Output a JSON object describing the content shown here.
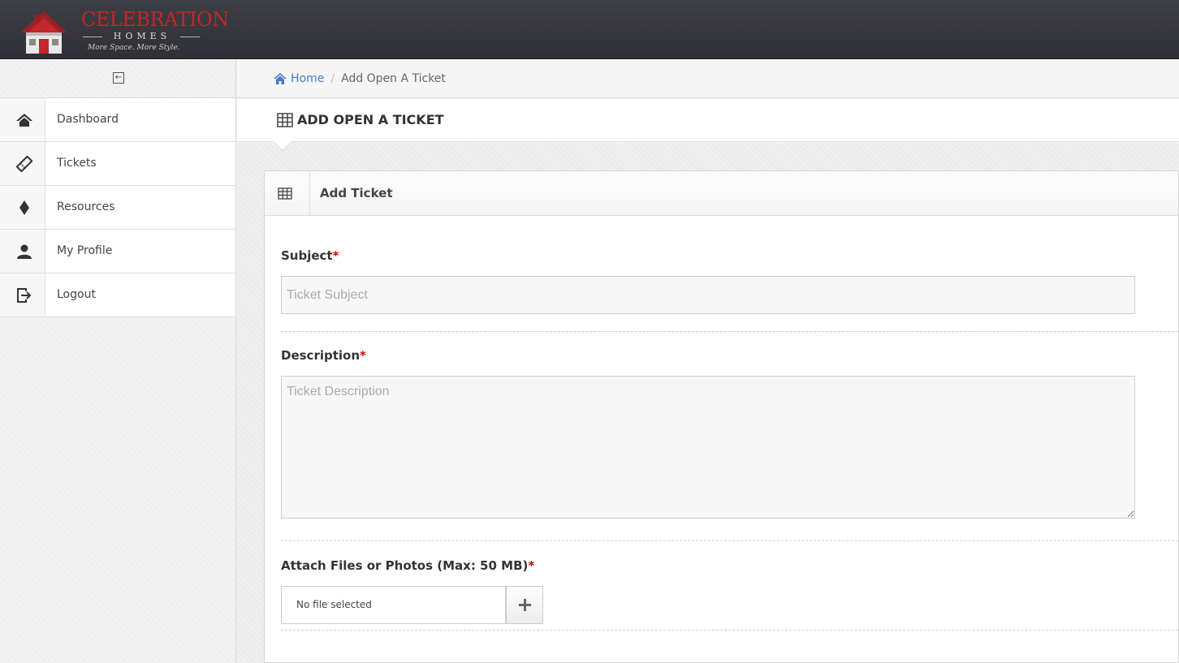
{
  "brand": {
    "name": "CELEBRATION",
    "sub": "HOMES",
    "tagline": "More Space. More Style."
  },
  "sidebar": {
    "collapse_icon": "collapse-left-icon",
    "items": [
      {
        "label": "Dashboard",
        "icon": "home-icon"
      },
      {
        "label": "Tickets",
        "icon": "ticket-icon"
      },
      {
        "label": "Resources",
        "icon": "diamond-icon"
      },
      {
        "label": "My Profile",
        "icon": "user-icon"
      },
      {
        "label": "Logout",
        "icon": "logout-icon"
      }
    ]
  },
  "breadcrumb": {
    "home": "Home",
    "separator": "/",
    "current": "Add Open A Ticket"
  },
  "page": {
    "title": "ADD OPEN A TICKET"
  },
  "widget": {
    "title": "Add Ticket"
  },
  "form": {
    "subject_label": "Subject",
    "subject_placeholder": "Ticket Subject",
    "subject_value": "",
    "description_label": "Description",
    "description_placeholder": "Ticket Description",
    "description_value": "",
    "attach_label": "Attach Files or Photos (Max: 50 MB)",
    "required_mark": "*",
    "file_status": "No file selected"
  },
  "colors": {
    "navbar": "#35363b",
    "brand_red": "#c1272d",
    "link_blue": "#4a7ac6",
    "required_red": "#dd0000"
  }
}
